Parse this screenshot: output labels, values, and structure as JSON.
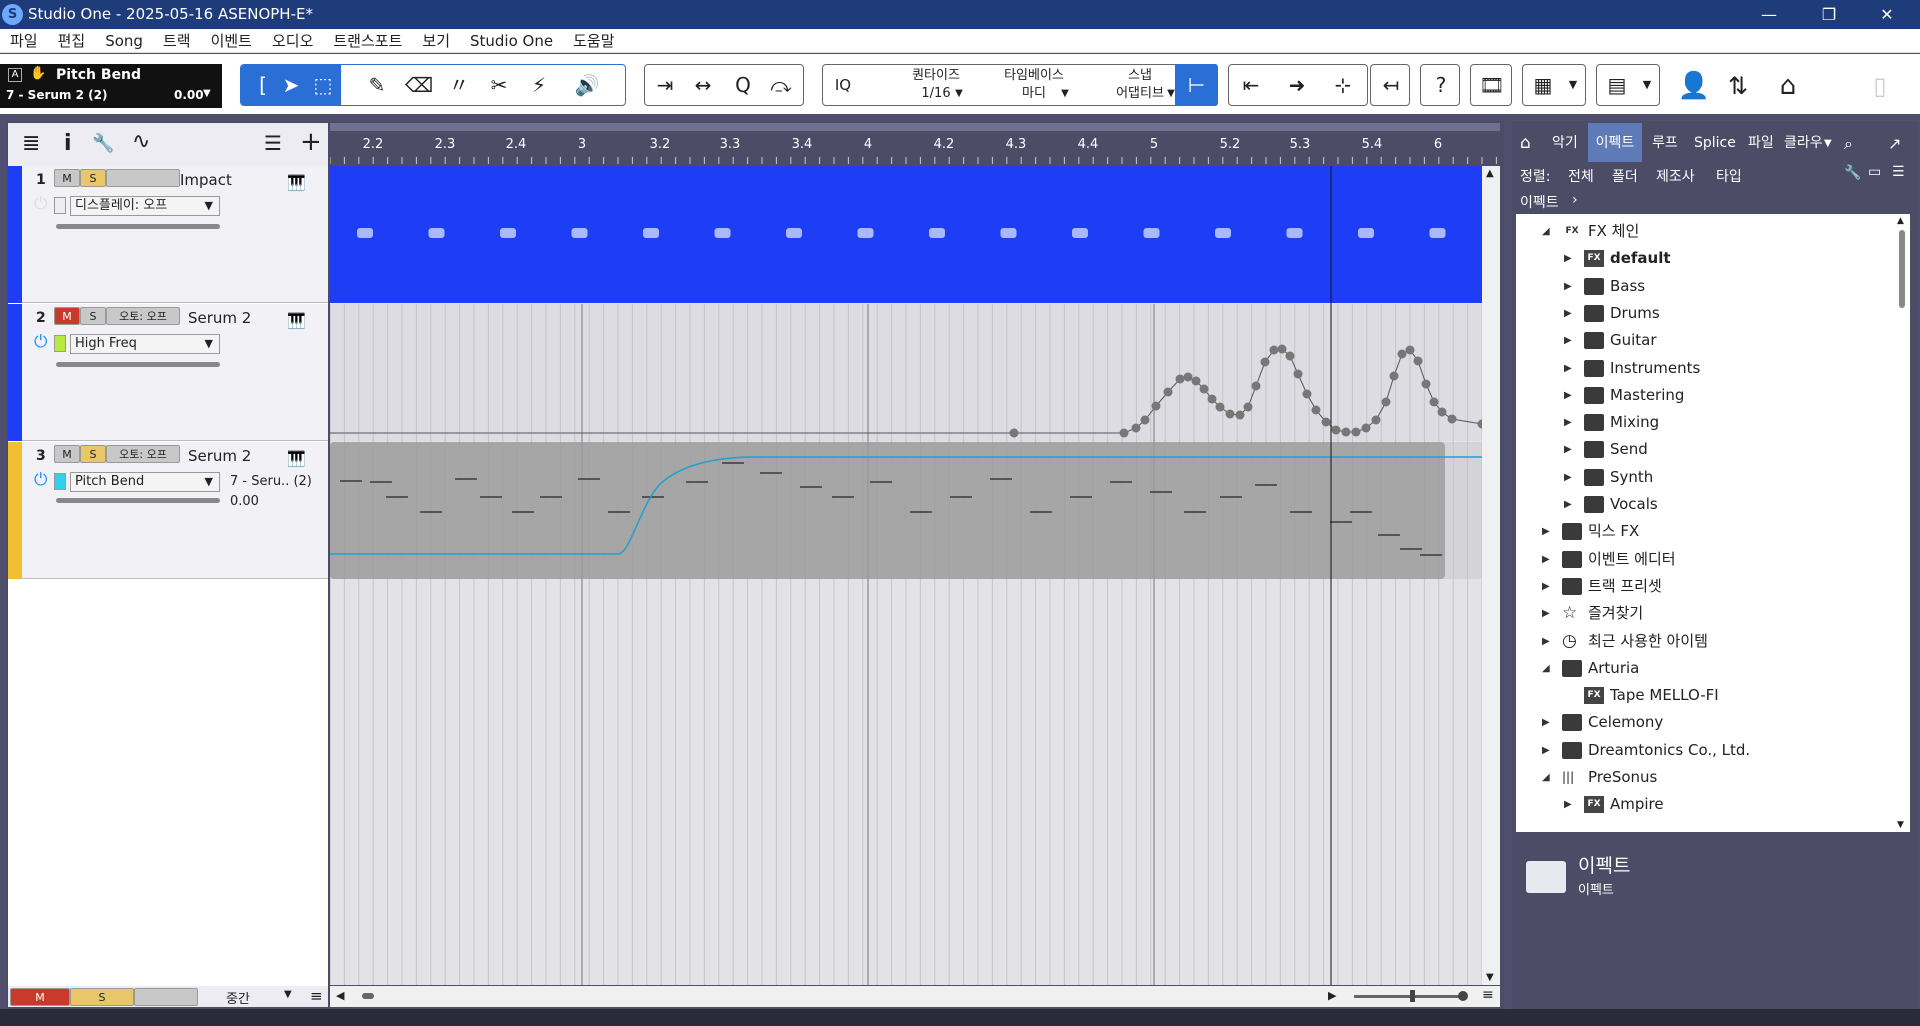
{
  "window": {
    "title": "Studio One - 2025-05-16 ASENOPH-E*",
    "logo": "S",
    "minimize": "—",
    "restore": "❐",
    "close": "✕"
  },
  "menu": [
    "파일",
    "편집",
    "Song",
    "트랙",
    "이벤트",
    "오디오",
    "트랜스포트",
    "보기",
    "Studio One",
    "도움말"
  ],
  "param": {
    "icon_a": "A",
    "hand_icon": "✋",
    "name": "Pitch Bend",
    "track": "7 - Serum 2 (2)",
    "value": "0.00"
  },
  "toolbar": {
    "quantize_label": "퀀타이즈",
    "quantize_value": "1/16",
    "timebase_label": "타임베이스",
    "timebase_value": "마디",
    "snap_label": "스냅",
    "snap_value": "어댑티브",
    "iq": "IQ",
    "help": "?"
  },
  "trackhead": {
    "list_icon": "≣",
    "info_icon": "i",
    "wrench_icon": "🔧",
    "auto_icon": "∿",
    "menu_icon": "☰",
    "add_icon": "+"
  },
  "tracks": [
    {
      "num": "1",
      "m": "M",
      "s": "S",
      "name": "Impact",
      "dropdown": "디스플레이: 오프",
      "color": "#1e3ef5"
    },
    {
      "num": "2",
      "m": "M",
      "s": "S",
      "auto": "오토: 오프",
      "name": "Serum 2",
      "dropdown": "High Freq",
      "color": "#1e3ef5",
      "swatch": "#b7ea3c"
    },
    {
      "num": "3",
      "m": "M",
      "s": "S",
      "auto": "오토: 오프",
      "name": "Serum 2",
      "dropdown": "Pitch Bend",
      "color": "#f0c030",
      "swatch": "#2fd0f0",
      "side_label": "7 - Seru.. (2)",
      "side_value": "0.00"
    }
  ],
  "bottombar": {
    "m": "M",
    "s": "S",
    "zoom": "중간"
  },
  "ruler": [
    "2.2",
    "2.3",
    "2.4",
    "3",
    "3.2",
    "3.3",
    "3.4",
    "4",
    "4.2",
    "4.3",
    "4.4",
    "5",
    "5.2",
    "5.3",
    "5.4",
    "6"
  ],
  "browser": {
    "tabs": [
      "악기",
      "이펙트",
      "루프",
      "Splice",
      "파일",
      "클라우"
    ],
    "active_tab": "이펙트",
    "sort_label": "정렬:",
    "sort_options": [
      "전체",
      "폴더",
      "제조사",
      "타입"
    ],
    "path": "이펙트",
    "tree": [
      {
        "label": "FX 체인",
        "level": 1,
        "open": true,
        "icon": "fxchain"
      },
      {
        "label": "default",
        "level": 2,
        "icon": "fx",
        "bold": true
      },
      {
        "label": "Bass",
        "level": 2,
        "icon": "folder"
      },
      {
        "label": "Drums",
        "level": 2,
        "icon": "folder"
      },
      {
        "label": "Guitar",
        "level": 2,
        "icon": "folder"
      },
      {
        "label": "Instruments",
        "level": 2,
        "icon": "folder"
      },
      {
        "label": "Mastering",
        "level": 2,
        "icon": "folder"
      },
      {
        "label": "Mixing",
        "level": 2,
        "icon": "folder"
      },
      {
        "label": "Send",
        "level": 2,
        "icon": "folder"
      },
      {
        "label": "Synth",
        "level": 2,
        "icon": "folder"
      },
      {
        "label": "Vocals",
        "level": 2,
        "icon": "folder"
      },
      {
        "label": "믹스 FX",
        "level": 1,
        "icon": "folder"
      },
      {
        "label": "이벤트 에디터",
        "level": 1,
        "icon": "folder"
      },
      {
        "label": "트랙 프리셋",
        "level": 1,
        "icon": "folder"
      },
      {
        "label": "즐겨찾기",
        "level": 1,
        "icon": "star"
      },
      {
        "label": "최근 사용한 아이템",
        "level": 1,
        "icon": "clock"
      },
      {
        "label": "Arturia",
        "level": 1,
        "open": true,
        "icon": "folder"
      },
      {
        "label": "Tape MELLO-FI",
        "level": 2,
        "icon": "fx",
        "noarrow": true
      },
      {
        "label": "Celemony",
        "level": 1,
        "icon": "folder"
      },
      {
        "label": "Dreamtonics Co., Ltd.",
        "level": 1,
        "icon": "folder"
      },
      {
        "label": "PreSonus",
        "level": 1,
        "open": true,
        "icon": "presonus"
      },
      {
        "label": "Ampire",
        "level": 2,
        "icon": "fx"
      }
    ],
    "info_title": "이펙트",
    "info_sub": "이펙트"
  }
}
